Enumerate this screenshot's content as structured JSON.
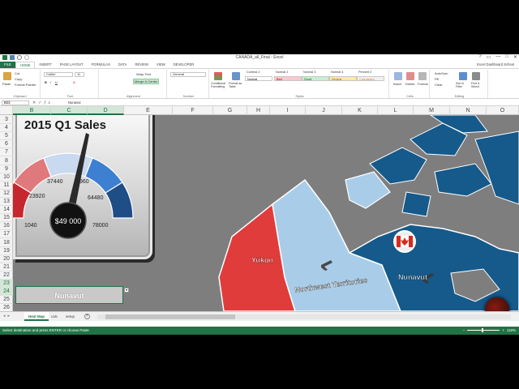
{
  "window": {
    "title": "CANADA_all_Final - Excel",
    "controls": [
      "?",
      "▭",
      "—",
      "□",
      "✕"
    ]
  },
  "tabs": [
    "FILE",
    "HOME",
    "INSERT",
    "PAGE LAYOUT",
    "FORMULAS",
    "DATA",
    "REVIEW",
    "VIEW",
    "DEVELOPER"
  ],
  "active_tab": "HOME",
  "sign_in": "Excel Dashboard School",
  "ribbon": {
    "clipboard": {
      "paste": "Paste",
      "cut": "Cut",
      "copy": "Copy",
      "format_painter": "Format Painter",
      "label": "Clipboard"
    },
    "font": {
      "name": "Calibri",
      "size": "11",
      "label": "Font"
    },
    "alignment": {
      "wrap": "Wrap Text",
      "merge": "Merge & Center",
      "label": "Alignment"
    },
    "number": {
      "format": "General",
      "label": "Number"
    },
    "styles": {
      "conditional": "Conditional Formatting",
      "format_table": "Format as Table",
      "headers": [
        "Comma 2",
        "Normal 2",
        "Normal 3",
        "Normal 4",
        "Percent 2"
      ],
      "cells": [
        "Normal",
        "Bad",
        "Good",
        "Neutral",
        "Calculation"
      ],
      "label": "Styles"
    },
    "cells": {
      "insert": "Insert",
      "delete": "Delete",
      "format": "Format",
      "label": "Cells"
    },
    "editing": {
      "autosum": "AutoSum",
      "fill": "Fill",
      "clear": "Clear",
      "sort": "Sort & Filter",
      "find": "Find & Select",
      "label": "Editing"
    }
  },
  "formula_bar": {
    "name_box": "B23",
    "fx": "fx",
    "formula": "Nunavut"
  },
  "columns": [
    "B",
    "C",
    "D",
    "E",
    "F",
    "G",
    "H",
    "I",
    "J",
    "K",
    "L",
    "M",
    "N",
    "O"
  ],
  "rows": [
    "3",
    "4",
    "5",
    "6",
    "7",
    "8",
    "9",
    "10",
    "11",
    "12",
    "13",
    "14",
    "15",
    "16",
    "17",
    "18",
    "19",
    "20",
    "21",
    "22",
    "23",
    "24",
    "25",
    "26"
  ],
  "gauge": {
    "title": "2015 Q1 Sales",
    "value_label": "$49 000",
    "ticks": [
      "1040",
      "23920",
      "37440",
      "960",
      "64480",
      "78000"
    ],
    "colors": [
      "#c6262e",
      "#e0797c",
      "#c9d9f0",
      "#3d7fd1",
      "#1f4d86"
    ]
  },
  "map": {
    "regions": [
      {
        "name": "Yukon",
        "color": "#e03c3c"
      },
      {
        "name": "Northwest Territories",
        "color": "#a9cde9"
      },
      {
        "name": "Nunavut",
        "color": "#155a8a"
      }
    ],
    "flag": "Canada"
  },
  "selected_cell_text": "Nunavut",
  "sheets": [
    "Heat Map",
    "calc",
    "setup"
  ],
  "active_sheet": "Heat Map",
  "status": {
    "message": "Select destination and press ENTER or choose Paste",
    "zoom": "118%"
  }
}
